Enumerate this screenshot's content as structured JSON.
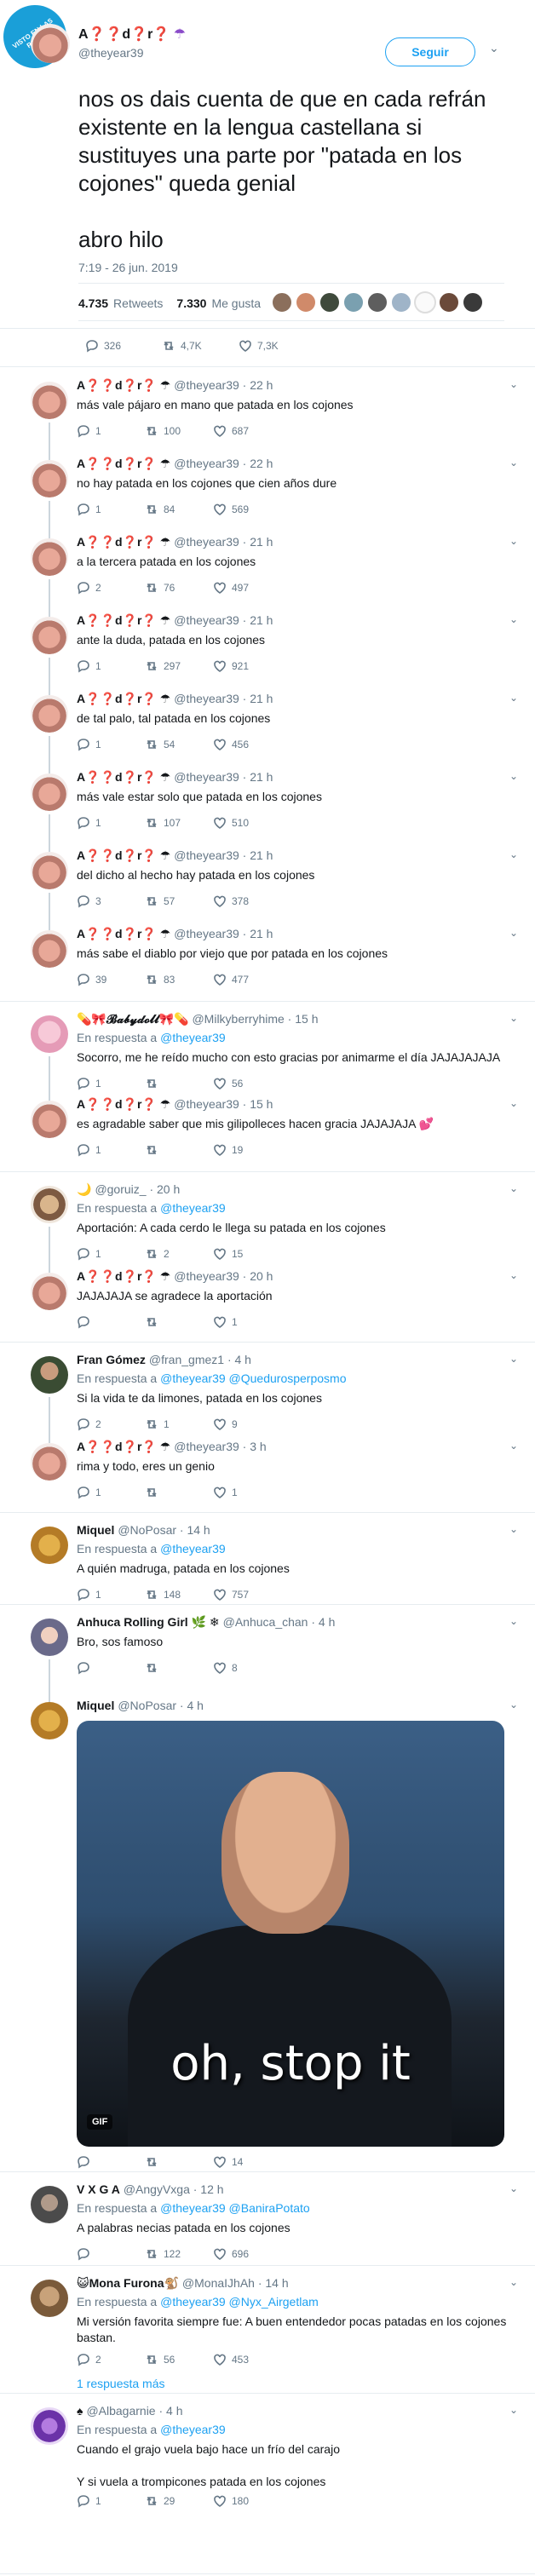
{
  "watermark": "VISTO EN LAS REDES",
  "main": {
    "name": "A❓❓d❓r❓",
    "umbrella": "☂",
    "handle": "@theyear39",
    "follow_label": "Seguir",
    "text": "nos os dais cuenta de que en cada refrán existente en la lengua castellana si sustituyes una parte por \"patada en los cojones\" queda genial\n\nabro hilo",
    "date": "7:19 - 26 jun. 2019",
    "retweets_count": "4.735",
    "retweets_label": "Retweets",
    "likes_count": "7.330",
    "likes_label": "Me gusta",
    "replies": "326",
    "rts": "4,7K",
    "likes": "7,3K"
  },
  "tweets": [
    {
      "name": "A❓❓d❓r❓ ☂",
      "meta": "@theyear39 · 22 h",
      "text": "más vale pájaro en mano que patada en los cojones",
      "r": "1",
      "rt": "100",
      "l": "687"
    },
    {
      "name": "A❓❓d❓r❓ ☂",
      "meta": "@theyear39 · 22 h",
      "text": "no hay patada en los cojones que cien años dure",
      "r": "1",
      "rt": "84",
      "l": "569"
    },
    {
      "name": "A❓❓d❓r❓ ☂",
      "meta": "@theyear39 · 21 h",
      "text": "a la tercera patada en los cojones",
      "r": "2",
      "rt": "76",
      "l": "497"
    },
    {
      "name": "A❓❓d❓r❓ ☂",
      "meta": "@theyear39 · 21 h",
      "text": "ante la duda, patada en los cojones",
      "r": "1",
      "rt": "297",
      "l": "921"
    },
    {
      "name": "A❓❓d❓r❓ ☂",
      "meta": "@theyear39 · 21 h",
      "text": "de tal palo, tal patada en los cojones",
      "r": "1",
      "rt": "54",
      "l": "456"
    },
    {
      "name": "A❓❓d❓r❓ ☂",
      "meta": "@theyear39 · 21 h",
      "text": "más vale estar solo que patada en los cojones",
      "r": "1",
      "rt": "107",
      "l": "510"
    },
    {
      "name": "A❓❓d❓r❓ ☂",
      "meta": "@theyear39 · 21 h",
      "text": "del dicho al hecho hay patada en los cojones",
      "r": "3",
      "rt": "57",
      "l": "378"
    },
    {
      "name": "A❓❓d❓r❓ ☂",
      "meta": "@theyear39 · 21 h",
      "text": "más sabe el diablo por viejo que por patada en los cojones",
      "r": "39",
      "rt": "83",
      "l": "477"
    },
    {
      "name": "💊🎀𝓑𝓪𝓫𝔂𝓭𝓸𝓵𝓵🎀💊",
      "meta": "@Milkyberryhime · 15 h",
      "reply_to": "@theyear39",
      "text": "Socorro, me he reído mucho con esto gracias por animarme el día JAJAJAJAJA",
      "r": "1",
      "rt": "",
      "l": "56"
    },
    {
      "name": "A❓❓d❓r❓ ☂",
      "meta": "@theyear39 · 15 h",
      "text": "es agradable saber que mis gilipolleces hacen gracia JAJAJAJA 💕",
      "r": "1",
      "rt": "",
      "l": "19"
    },
    {
      "name": "🌙",
      "meta": "@goruiz_ · 20 h",
      "reply_to": "@theyear39",
      "text": "Aportación: A cada cerdo le llega su patada en los cojones",
      "r": "1",
      "rt": "2",
      "l": "15"
    },
    {
      "name": "A❓❓d❓r❓ ☂",
      "meta": "@theyear39 · 20 h",
      "text": "JAJAJAJA se agradece la aportación",
      "r": "",
      "rt": "",
      "l": "1"
    },
    {
      "name": "Fran Gómez",
      "meta": "@fran_gmez1 · 4 h",
      "reply_to": "@theyear39 @Quedurosperposmo",
      "text": "Si la vida te da limones, patada en los cojones",
      "r": "2",
      "rt": "1",
      "l": "9"
    },
    {
      "name": "A❓❓d❓r❓ ☂",
      "meta": "@theyear39 · 3 h",
      "text": "rima y todo, eres un genio",
      "r": "1",
      "rt": "",
      "l": "1"
    },
    {
      "name": "Miquel",
      "meta": "@NoPosar · 14 h",
      "reply_to": "@theyear39",
      "text": "A quién madruga, patada en los cojones",
      "r": "1",
      "rt": "148",
      "l": "757"
    },
    {
      "name": "Anhuca Rolling Girl 🌿 ❄",
      "meta": "@Anhuca_chan · 4 h",
      "text": "Bro, sos famoso",
      "r": "",
      "rt": "",
      "l": "8"
    },
    {
      "name": "Miquel",
      "meta": "@NoPosar · 4 h",
      "text": "",
      "r": "",
      "rt": "",
      "l": "14"
    },
    {
      "name": "V X G A",
      "meta": "@AngyVxga · 12 h",
      "reply_to": "@theyear39 @BaniraPotato",
      "text": "A palabras necias patada en los cojones",
      "r": "",
      "rt": "122",
      "l": "696"
    },
    {
      "name": "😺Mona Furona🐒",
      "meta": "@MonaIJhAh · 14 h",
      "reply_to": "@theyear39 @Nyx_Airgetlam",
      "text": "Mi versión favorita siempre fue: A buen entendedor pocas patadas en los cojones bastan.",
      "r": "2",
      "rt": "56",
      "l": "453"
    },
    {
      "name": "♠",
      "meta": "@Albagarnie · 4 h",
      "reply_to": "@theyear39",
      "text": "Cuando el grajo vuela bajo hace un frío del carajo\n\nY si vuela a trompicones patada en los cojones",
      "r": "1",
      "rt": "29",
      "l": "180"
    }
  ],
  "reply_prefix": "En respuesta a",
  "more_replies": "1 respuesta más",
  "gif": {
    "caption": "oh, stop it",
    "badge": "GIF"
  }
}
